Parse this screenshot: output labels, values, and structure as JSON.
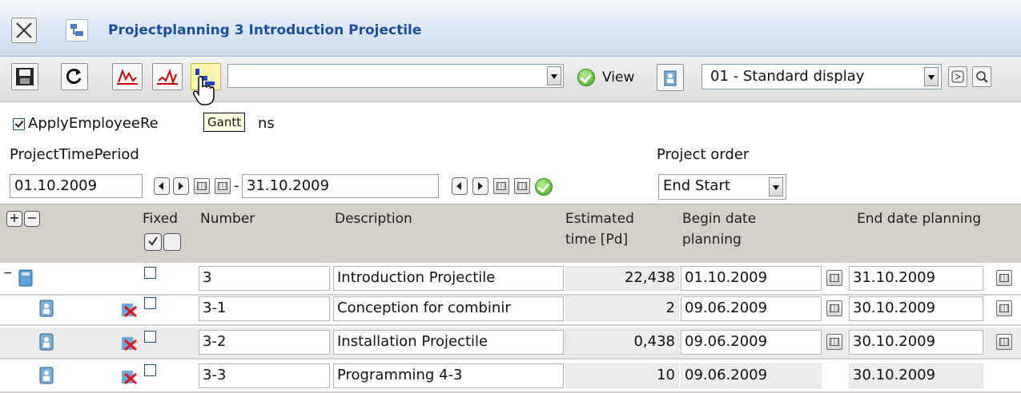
{
  "window": {
    "title": "Projectplanning 3 Introduction Projectile"
  },
  "toolbar": {
    "buttons": [
      "save-icon",
      "refresh-icon",
      "chart-red-icon",
      "chart-red2-icon",
      "gantt-icon"
    ],
    "main_combo_value": "",
    "view_label": "View",
    "view_value": "01 - Standard display"
  },
  "tooltip": {
    "text": "Gantt"
  },
  "options": {
    "apply_employee_label_left": "ApplyEmployeeRe",
    "apply_employee_label_right": "ns",
    "apply_employee_checked": true,
    "period_label": "ProjectTimePeriod",
    "period_from": "01.10.2009",
    "period_separator": "-",
    "period_to": "31.10.2009",
    "order_label": "Project order",
    "order_value": "End Start"
  },
  "grid": {
    "headers": {
      "fixed": "Fixed",
      "number": "Number",
      "description": "Description",
      "estimated_1": "Estimated",
      "estimated_2": "time [Pd]",
      "begin_1": "Begin date",
      "begin_2": "planning",
      "end": "End date planning"
    },
    "rows": [
      {
        "number": "3",
        "description": "Introduction Projectile",
        "estimated": "22,438",
        "begin": "01.10.2009",
        "end": "31.10.2009"
      },
      {
        "number": "3-1",
        "description": "Conception for combinir",
        "estimated": "2",
        "begin": "09.06.2009",
        "end": "30.10.2009"
      },
      {
        "number": "3-2",
        "description": "Installation  Projectile",
        "estimated": "0,438",
        "begin": "09.06.2009",
        "end": "30.10.2009"
      },
      {
        "number": "3-3",
        "description": "Programming 4-3",
        "estimated": "10",
        "begin": "09.06.2009",
        "end": "30.10.2009"
      }
    ]
  },
  "colors": {
    "title_text": "#1b4f9c",
    "header_bg": "#d4d0c8",
    "ok_green": "#3aa41f",
    "tooltip_bg": "#ffffe1"
  }
}
